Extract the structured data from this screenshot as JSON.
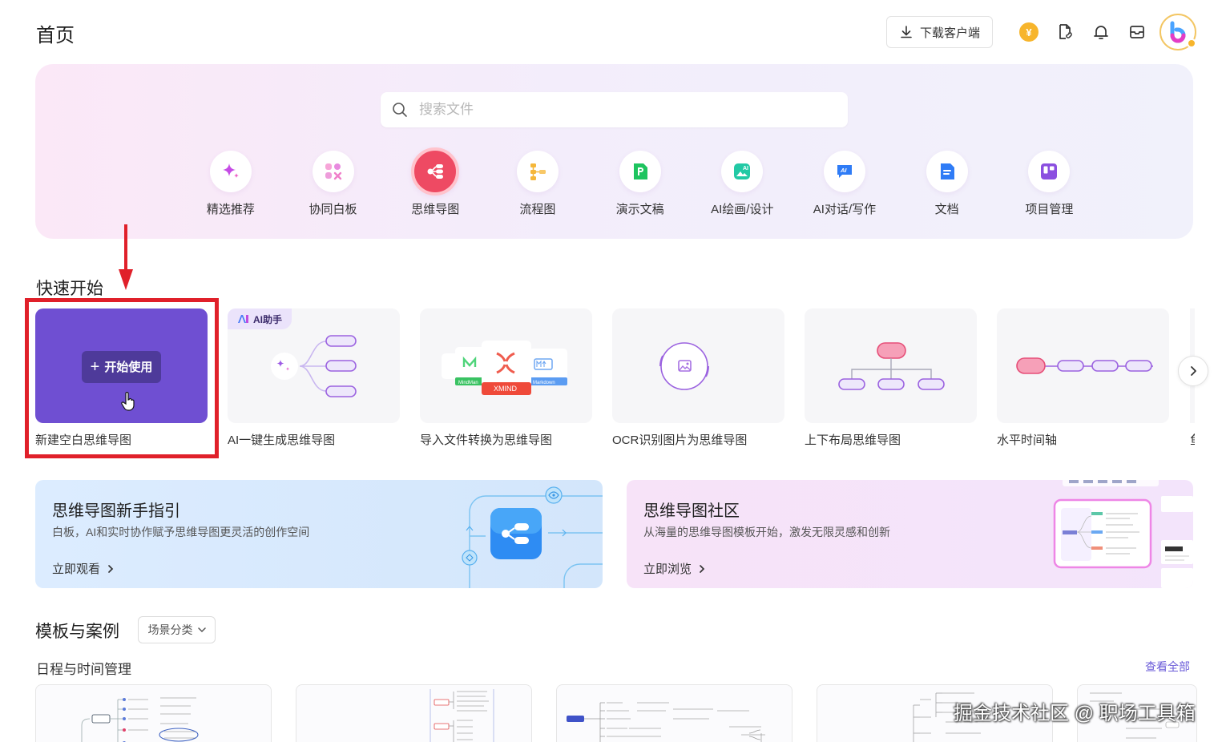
{
  "header": {
    "title": "首页",
    "download_label": "下载客户端",
    "coin_symbol": "¥"
  },
  "search": {
    "placeholder": "搜索文件"
  },
  "categories": [
    {
      "label": "精选推荐",
      "icon": "sparkle-icon"
    },
    {
      "label": "协同白板",
      "icon": "whiteboard-icon"
    },
    {
      "label": "思维导图",
      "icon": "mindmap-icon"
    },
    {
      "label": "流程图",
      "icon": "flowchart-icon"
    },
    {
      "label": "演示文稿",
      "icon": "presentation-icon"
    },
    {
      "label": "AI绘画/设计",
      "icon": "ai-image-icon"
    },
    {
      "label": "AI对话/写作",
      "icon": "ai-chat-icon"
    },
    {
      "label": "文档",
      "icon": "document-icon"
    },
    {
      "label": "项目管理",
      "icon": "project-icon"
    }
  ],
  "quick_start": {
    "title": "快速开始",
    "start_button": "开始使用",
    "ai_badge": "AI助手",
    "import_logos": [
      "XMIND",
      "MindMan",
      "Markdown"
    ],
    "items": [
      {
        "label": "新建空白思维导图"
      },
      {
        "label": "AI一键生成思维导图"
      },
      {
        "label": "导入文件转换为思维导图"
      },
      {
        "label": "OCR识别图片为思维导图"
      },
      {
        "label": "上下布局思维导图"
      },
      {
        "label": "水平时间轴"
      }
    ],
    "edge_label": "鱼"
  },
  "banners": {
    "guide": {
      "title": "思维导图新手指引",
      "desc": "白板，AI和实时协作赋予思维导图更灵活的创作空间",
      "link": "立即观看"
    },
    "community": {
      "title": "思维导图社区",
      "desc": "从海量的思维导图模板开始，激发无限灵感和创新",
      "link": "立即浏览"
    }
  },
  "templates": {
    "title": "模板与案例",
    "filter": "场景分类",
    "subsection": "日程与时间管理",
    "see_all": "查看全部"
  },
  "watermark": "掘金技术社区 @ 职场工具箱",
  "colors": {
    "accent": "#6f4fd2",
    "mindmap_active": "#ee4a63",
    "highlight": "#e0202a"
  }
}
